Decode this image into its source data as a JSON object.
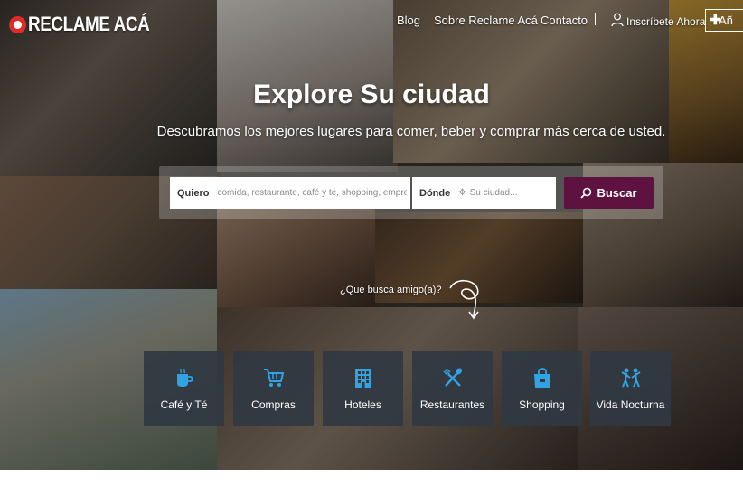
{
  "header": {
    "logo_text": "RECLAME ACÁ",
    "nav": [
      {
        "label": "Blog"
      },
      {
        "label": "Sobre Reclame Acá"
      },
      {
        "label": "Contacto"
      }
    ],
    "register_label": "Inscríbete Ahora",
    "add_label": "Añ"
  },
  "hero": {
    "title": "Explore Su ciudad",
    "subtitle": "Descubramos los mejores lugares para comer, beber y comprar más cerca de usted."
  },
  "search": {
    "what_label": "Quiero",
    "what_placeholder": "comida, restaurante, café y té, shopping, empresa",
    "where_label": "Dónde",
    "where_placeholder": "Su ciudad...",
    "button_label": "Buscar"
  },
  "prompt": "¿Que busca amigo(a)?",
  "categories": [
    {
      "label": "Café y Té",
      "icon": "coffee-cup-icon"
    },
    {
      "label": "Compras",
      "icon": "shopping-cart-icon"
    },
    {
      "label": "Hoteles",
      "icon": "hotel-building-icon"
    },
    {
      "label": "Restaurantes",
      "icon": "fork-spoon-icon"
    },
    {
      "label": "Shopping",
      "icon": "shopping-bag-icon"
    },
    {
      "label": "Vida Nocturna",
      "icon": "dancing-people-icon"
    }
  ],
  "colors": {
    "accent": "#5e1240",
    "logo_red": "#e02b2b",
    "icon_blue": "#2fa3e6",
    "tile_bg": "#303842"
  }
}
